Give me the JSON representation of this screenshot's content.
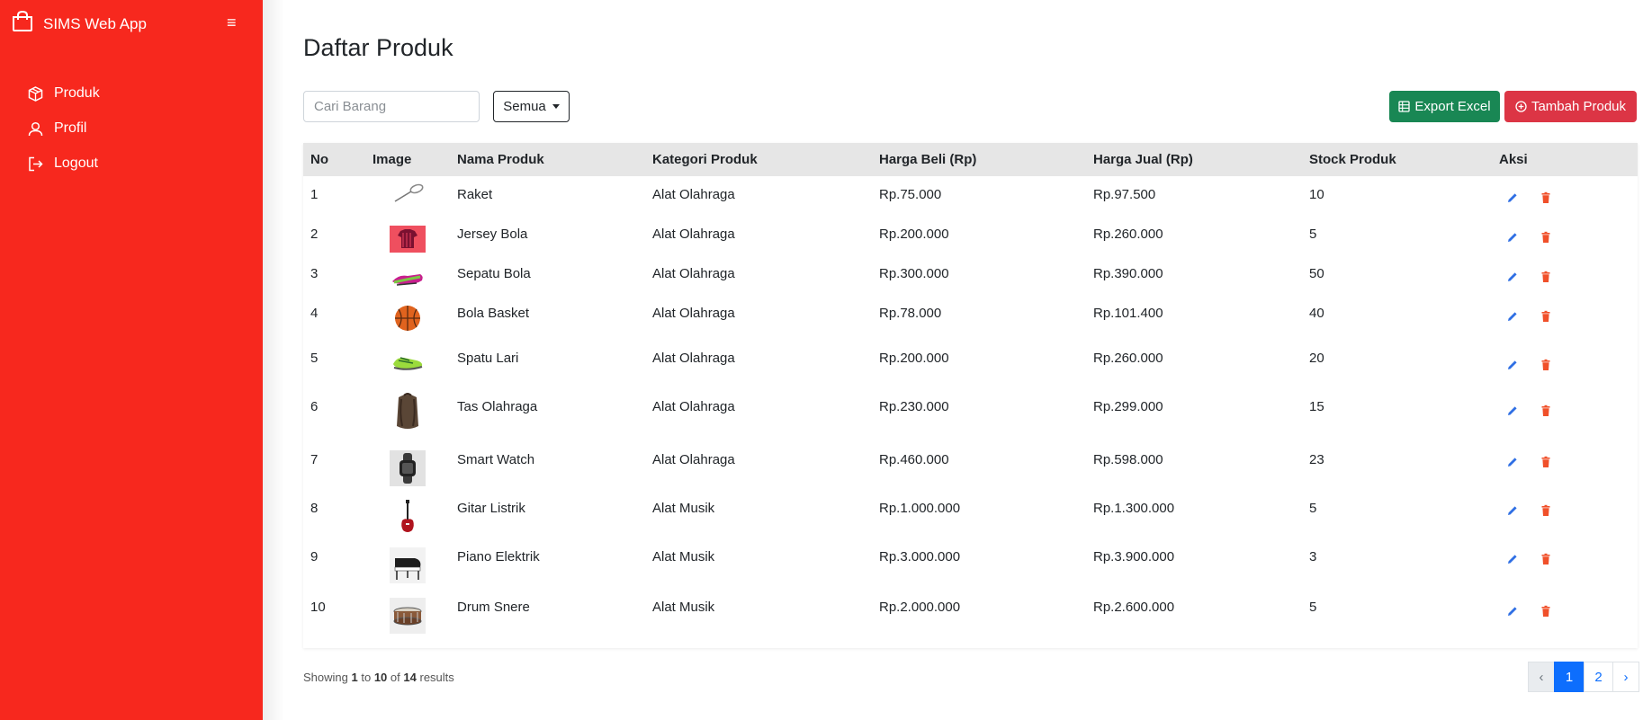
{
  "app": {
    "title": "SIMS Web App",
    "hamburger": "≡"
  },
  "sidebar": {
    "items": [
      {
        "label": "Produk",
        "icon": "box-icon"
      },
      {
        "label": "Profil",
        "icon": "user-icon"
      },
      {
        "label": "Logout",
        "icon": "logout-icon"
      }
    ]
  },
  "page": {
    "title": "Daftar Produk"
  },
  "search": {
    "placeholder": "Cari Barang",
    "value": ""
  },
  "filter": {
    "selected": "Semua"
  },
  "actions": {
    "export_label": "Export Excel",
    "add_label": "Tambah Produk"
  },
  "table": {
    "headers": [
      "No",
      "Image",
      "Nama Produk",
      "Kategori Produk",
      "Harga Beli (Rp)",
      "Harga Jual (Rp)",
      "Stock Produk",
      "Aksi"
    ],
    "rows": [
      {
        "no": "1",
        "image": "racket",
        "name": "Raket",
        "category": "Alat Olahraga",
        "buy": "Rp.75.000",
        "sell": "Rp.97.500",
        "stock": "10"
      },
      {
        "no": "2",
        "image": "jersey",
        "name": "Jersey Bola",
        "category": "Alat Olahraga",
        "buy": "Rp.200.000",
        "sell": "Rp.260.000",
        "stock": "5"
      },
      {
        "no": "3",
        "image": "football-shoe",
        "name": "Sepatu Bola",
        "category": "Alat Olahraga",
        "buy": "Rp.300.000",
        "sell": "Rp.390.000",
        "stock": "50"
      },
      {
        "no": "4",
        "image": "basketball",
        "name": "Bola Basket",
        "category": "Alat Olahraga",
        "buy": "Rp.78.000",
        "sell": "Rp.101.400",
        "stock": "40"
      },
      {
        "no": "5",
        "image": "running-shoe",
        "name": "Spatu Lari",
        "category": "Alat Olahraga",
        "buy": "Rp.200.000",
        "sell": "Rp.260.000",
        "stock": "20"
      },
      {
        "no": "6",
        "image": "sports-bag",
        "name": "Tas Olahraga",
        "category": "Alat Olahraga",
        "buy": "Rp.230.000",
        "sell": "Rp.299.000",
        "stock": "15"
      },
      {
        "no": "7",
        "image": "smart-watch",
        "name": "Smart Watch",
        "category": "Alat Olahraga",
        "buy": "Rp.460.000",
        "sell": "Rp.598.000",
        "stock": "23"
      },
      {
        "no": "8",
        "image": "electric-guitar",
        "name": "Gitar Listrik",
        "category": "Alat Musik",
        "buy": "Rp.1.000.000",
        "sell": "Rp.1.300.000",
        "stock": "5"
      },
      {
        "no": "9",
        "image": "piano",
        "name": "Piano Elektrik",
        "category": "Alat Musik",
        "buy": "Rp.3.000.000",
        "sell": "Rp.3.900.000",
        "stock": "3"
      },
      {
        "no": "10",
        "image": "snare-drum",
        "name": "Drum Snere",
        "category": "Alat Musik",
        "buy": "Rp.2.000.000",
        "sell": "Rp.2.600.000",
        "stock": "5"
      }
    ]
  },
  "footer": {
    "showing_prefix": "Showing",
    "from": "1",
    "to_word": "to",
    "to": "10",
    "of_word": "of",
    "total": "14",
    "suffix": "results"
  },
  "pagination": {
    "prev": "‹",
    "pages": [
      "1",
      "2"
    ],
    "next": "›",
    "current": "1"
  },
  "colors": {
    "sidebar": "#f7281e",
    "excel": "#198754",
    "add": "#dc3545",
    "edit": "#2f6fe4",
    "delete": "#f0502a",
    "active_page": "#0d6efd"
  }
}
